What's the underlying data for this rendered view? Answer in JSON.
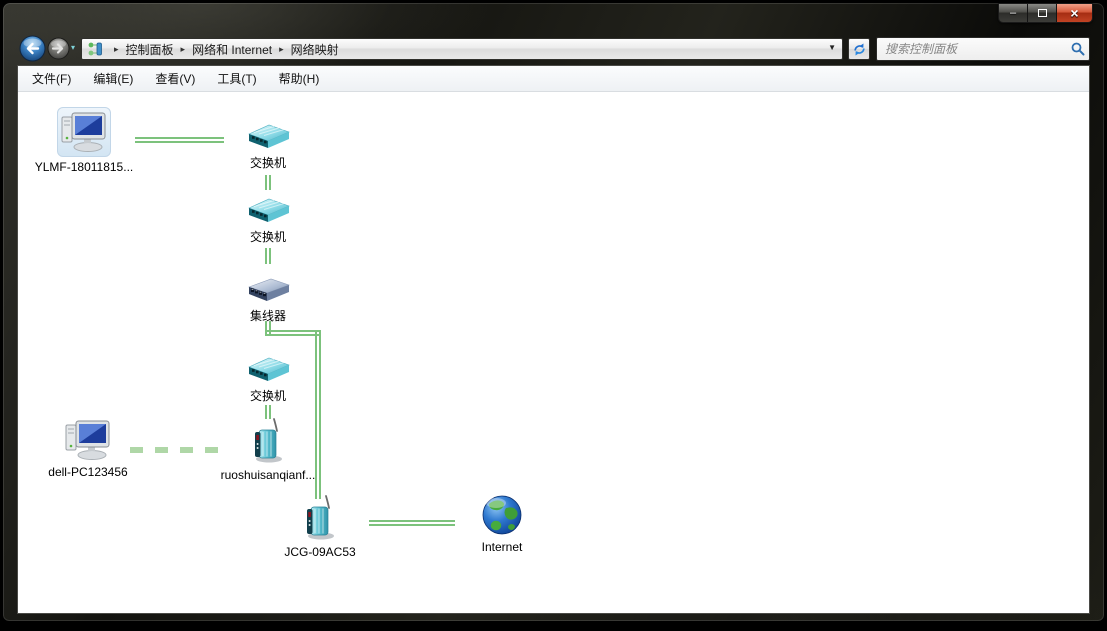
{
  "window": {
    "controls": [
      {
        "name": "minimize",
        "glyph": "–"
      },
      {
        "name": "maximize",
        "glyph": ""
      },
      {
        "name": "close",
        "glyph": "×"
      }
    ]
  },
  "navbar": {
    "breadcrumb": {
      "separator": "▸",
      "items": [
        "控制面板",
        "网络和 Internet",
        "网络映射"
      ]
    },
    "dropdown_glyph": "▼",
    "history_chevron_glyph": "▾",
    "search": {
      "placeholder": "搜索控制面板"
    }
  },
  "menubar": {
    "items": [
      "文件(F)",
      "编辑(E)",
      "查看(V)",
      "工具(T)",
      "帮助(H)"
    ]
  },
  "network_map": {
    "link_color": "#7cc27c",
    "nodes": [
      {
        "id": "local-computer",
        "type": "computer",
        "label": "YLMF-18011815..."
      },
      {
        "id": "switch-1",
        "type": "switch",
        "label": "交换机"
      },
      {
        "id": "switch-2",
        "type": "switch",
        "label": "交换机"
      },
      {
        "id": "hub",
        "type": "hub",
        "label": "集线器"
      },
      {
        "id": "switch-3",
        "type": "switch",
        "label": "交换机"
      },
      {
        "id": "remote-computer",
        "type": "computer",
        "label": "dell-PC123456"
      },
      {
        "id": "wireless-ap",
        "type": "wireless-router",
        "label": "ruoshuisanqianf..."
      },
      {
        "id": "gateway-router",
        "type": "wireless-router",
        "label": "JCG-09AC53"
      },
      {
        "id": "internet",
        "type": "globe",
        "label": "Internet"
      }
    ]
  }
}
